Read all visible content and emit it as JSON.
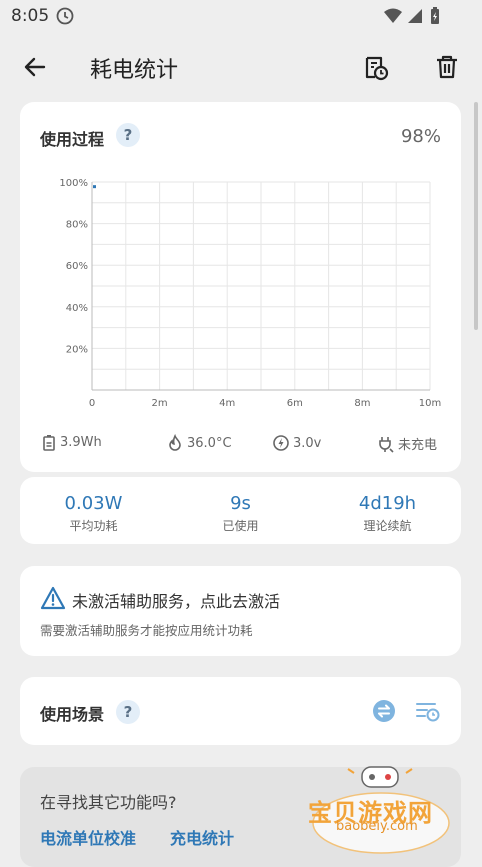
{
  "status": {
    "time": "8:05"
  },
  "appbar": {
    "title": "耗电统计"
  },
  "usage_card": {
    "title": "使用过程",
    "help": "?",
    "percent": "98%",
    "stats": {
      "energy": "3.9Wh",
      "temp": "36.0°C",
      "voltage": "3.0v",
      "charging": "未充电"
    }
  },
  "chart_data": {
    "type": "line",
    "x_ticks": [
      "0",
      "2m",
      "4m",
      "6m",
      "8m",
      "10m"
    ],
    "y_ticks": [
      "20%",
      "40%",
      "60%",
      "80%",
      "100%"
    ],
    "xlim": [
      0,
      10
    ],
    "ylim": [
      0,
      100
    ],
    "grid": true,
    "series": [
      {
        "x": [
          0
        ],
        "y": [
          98
        ]
      }
    ],
    "colors": {
      "line": "#2f78b6"
    }
  },
  "metrics": [
    {
      "value": "0.03W",
      "label": "平均功耗"
    },
    {
      "value": "9s",
      "label": "已使用"
    },
    {
      "value": "4d19h",
      "label": "理论续航"
    }
  ],
  "warning": {
    "title": "未激活辅助服务，点此去激活",
    "subtitle": "需要激活辅助服务才能按应用统计功耗"
  },
  "scene_card": {
    "title": "使用场景",
    "help": "?"
  },
  "more_card": {
    "question": "在寻找其它功能吗?",
    "links": [
      "电流单位校准",
      "充电统计"
    ]
  },
  "watermark": {
    "text": "宝贝游戏网",
    "url": "baobeiy.com"
  },
  "colors": {
    "accent": "#2f78b6",
    "background": "#eeeeee",
    "card": "#ffffff"
  }
}
